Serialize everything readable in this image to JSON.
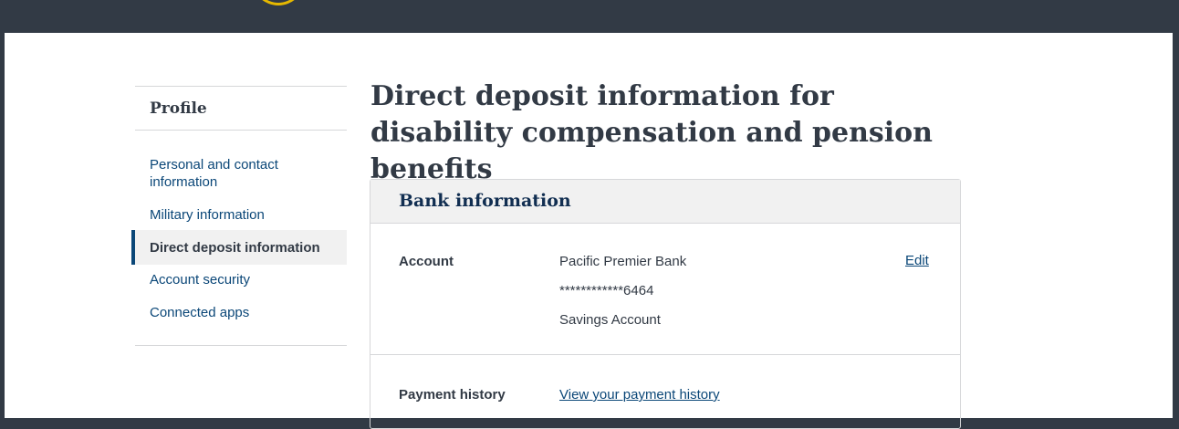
{
  "sidebar": {
    "heading": "Profile",
    "items": [
      {
        "label": "Personal and contact information"
      },
      {
        "label": "Military information"
      },
      {
        "label": "Direct deposit information"
      },
      {
        "label": "Account security"
      },
      {
        "label": "Connected apps"
      }
    ],
    "active_index": 2
  },
  "main": {
    "title": "Direct deposit information for disability compensation and pension benefits",
    "card": {
      "title": "Bank information",
      "account": {
        "label": "Account",
        "bank_name": "Pacific Premier Bank",
        "account_number": "************6464",
        "account_type": "Savings Account",
        "edit_label": "Edit"
      },
      "payment_history": {
        "label": "Payment history",
        "link": "View your payment history"
      }
    }
  },
  "colors": {
    "header_bg": "#323a45",
    "link": "#0b4778",
    "active_bg": "#f1f1f1",
    "card_title": "#112e51",
    "logo_accent": "#e6b800"
  }
}
